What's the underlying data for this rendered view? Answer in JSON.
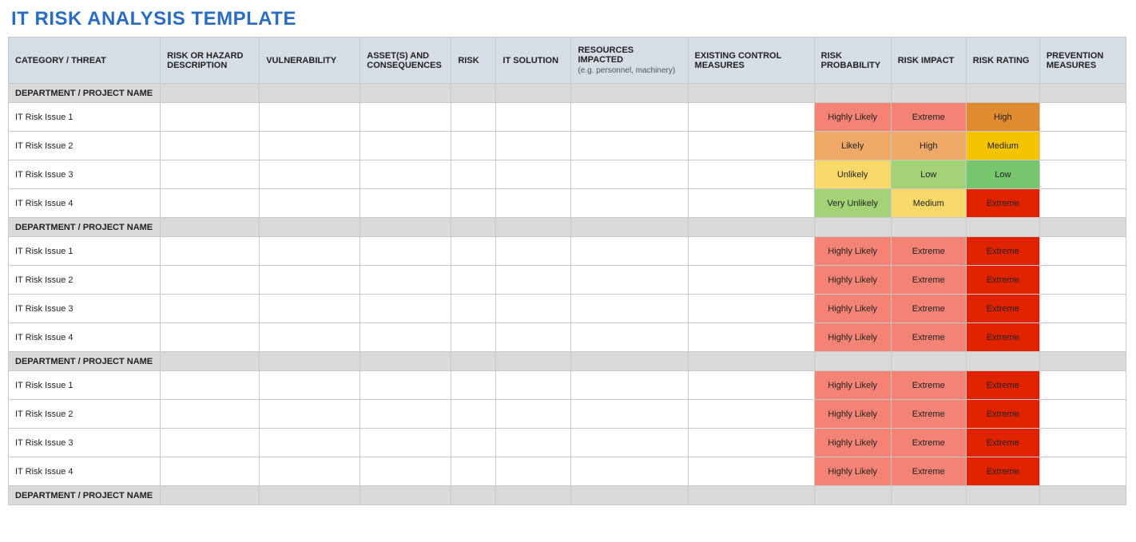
{
  "title": "IT RISK ANALYSIS TEMPLATE",
  "columns": [
    {
      "label": "CATEGORY / THREAT",
      "sub": ""
    },
    {
      "label": "RISK OR HAZARD DESCRIPTION",
      "sub": ""
    },
    {
      "label": "VULNERABILITY",
      "sub": ""
    },
    {
      "label": "ASSET(S) AND CONSEQUENCES",
      "sub": ""
    },
    {
      "label": "RISK",
      "sub": ""
    },
    {
      "label": "IT SOLUTION",
      "sub": ""
    },
    {
      "label": "RESOURCES IMPACTED",
      "sub": "(e.g. personnel, machinery)"
    },
    {
      "label": "EXISTING CONTROL MEASURES",
      "sub": ""
    },
    {
      "label": "RISK PROBABILITY",
      "sub": ""
    },
    {
      "label": "RISK IMPACT",
      "sub": ""
    },
    {
      "label": "RISK RATING",
      "sub": ""
    },
    {
      "label": "PREVENTION MEASURES",
      "sub": ""
    }
  ],
  "sections": [
    {
      "header": "DEPARTMENT / PROJECT NAME",
      "rows": [
        {
          "name": "IT Risk Issue 1",
          "prob": "Highly Likely",
          "probClass": "c-hl",
          "impact": "Extreme",
          "impactClass": "c-hl",
          "rating": "High",
          "ratingClass": "c-high"
        },
        {
          "name": "IT Risk Issue 2",
          "prob": "Likely",
          "probClass": "c-lk",
          "impact": "High",
          "impactClass": "c-lk",
          "rating": "Medium",
          "ratingClass": "c-med"
        },
        {
          "name": "IT Risk Issue 3",
          "prob": "Unlikely",
          "probClass": "c-ul",
          "impact": "Low",
          "impactClass": "c-vul",
          "rating": "Low",
          "ratingClass": "c-green"
        },
        {
          "name": "IT Risk Issue 4",
          "prob": "Very Unlikely",
          "probClass": "c-vul",
          "impact": "Medium",
          "impactClass": "c-ul",
          "rating": "Extreme",
          "ratingClass": "c-ext"
        }
      ]
    },
    {
      "header": "DEPARTMENT / PROJECT NAME",
      "rows": [
        {
          "name": "IT Risk Issue 1",
          "prob": "Highly Likely",
          "probClass": "c-hl",
          "impact": "Extreme",
          "impactClass": "c-hl",
          "rating": "Extreme",
          "ratingClass": "c-ext"
        },
        {
          "name": "IT Risk Issue 2",
          "prob": "Highly Likely",
          "probClass": "c-hl",
          "impact": "Extreme",
          "impactClass": "c-hl",
          "rating": "Extreme",
          "ratingClass": "c-ext"
        },
        {
          "name": "IT Risk Issue 3",
          "prob": "Highly Likely",
          "probClass": "c-hl",
          "impact": "Extreme",
          "impactClass": "c-hl",
          "rating": "Extreme",
          "ratingClass": "c-ext"
        },
        {
          "name": "IT Risk Issue 4",
          "prob": "Highly Likely",
          "probClass": "c-hl",
          "impact": "Extreme",
          "impactClass": "c-hl",
          "rating": "Extreme",
          "ratingClass": "c-ext"
        }
      ]
    },
    {
      "header": "DEPARTMENT / PROJECT NAME",
      "rows": [
        {
          "name": "IT Risk Issue 1",
          "prob": "Highly Likely",
          "probClass": "c-hl",
          "impact": "Extreme",
          "impactClass": "c-hl",
          "rating": "Extreme",
          "ratingClass": "c-ext"
        },
        {
          "name": "IT Risk Issue 2",
          "prob": "Highly Likely",
          "probClass": "c-hl",
          "impact": "Extreme",
          "impactClass": "c-hl",
          "rating": "Extreme",
          "ratingClass": "c-ext"
        },
        {
          "name": "IT Risk Issue 3",
          "prob": "Highly Likely",
          "probClass": "c-hl",
          "impact": "Extreme",
          "impactClass": "c-hl",
          "rating": "Extreme",
          "ratingClass": "c-ext"
        },
        {
          "name": "IT Risk Issue 4",
          "prob": "Highly Likely",
          "probClass": "c-hl",
          "impact": "Extreme",
          "impactClass": "c-hl",
          "rating": "Extreme",
          "ratingClass": "c-ext"
        }
      ]
    },
    {
      "header": "DEPARTMENT / PROJECT NAME",
      "rows": []
    }
  ]
}
